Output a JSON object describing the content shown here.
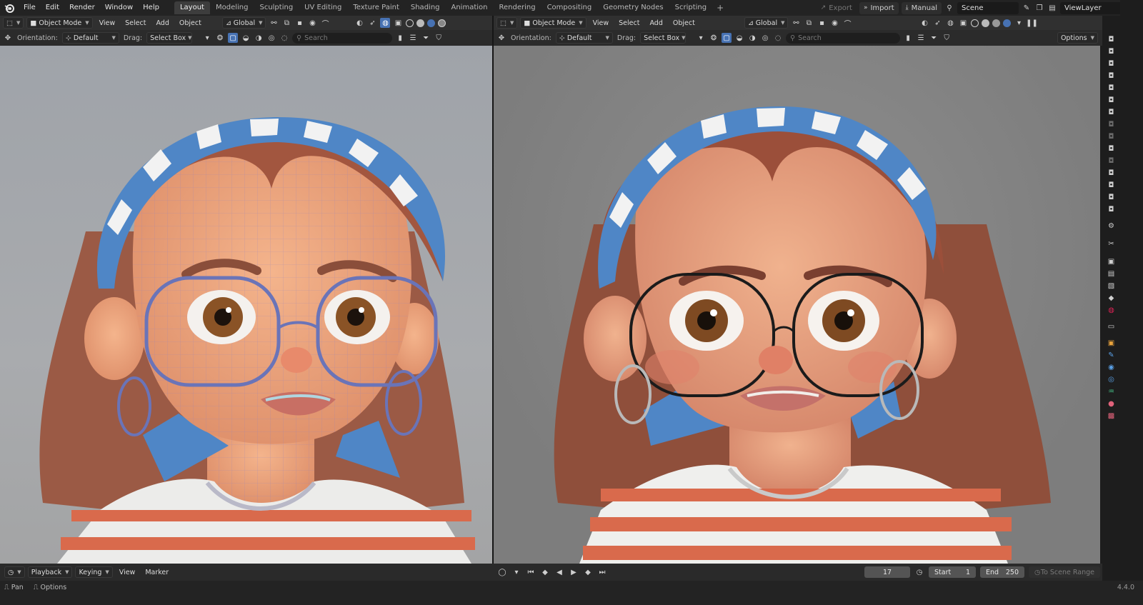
{
  "app": {
    "main_menu": [
      "File",
      "Edit",
      "Render",
      "Window",
      "Help"
    ],
    "workspaces": [
      "Layout",
      "Modeling",
      "Sculpting",
      "UV Editing",
      "Texture Paint",
      "Shading",
      "Animation",
      "Rendering",
      "Compositing",
      "Geometry Nodes",
      "Scripting"
    ],
    "active_workspace": "Layout",
    "export_label": "Export",
    "import_label": "Import",
    "manual_label": "Manual",
    "scene_name": "Scene",
    "viewlayer_name": "ViewLayer"
  },
  "left_viewport": {
    "mode": "Object Mode",
    "menus": [
      "View",
      "Select",
      "Add",
      "Object"
    ],
    "transform_space": "Global",
    "orientation_label": "Orientation:",
    "orientation_value": "Default",
    "drag_label": "Drag:",
    "drag_value": "Select Box",
    "search_placeholder": "Search",
    "shading": "wireframe-overlay"
  },
  "right_viewport": {
    "mode": "Object Mode",
    "menus": [
      "View",
      "Select",
      "Add",
      "Object"
    ],
    "transform_space": "Global",
    "orientation_label": "Orientation:",
    "orientation_value": "Default",
    "drag_label": "Drag:",
    "drag_value": "Select Box",
    "search_placeholder": "Search",
    "options_label": "Options",
    "shading": "rendered"
  },
  "timeline": {
    "menus": [
      "Playback",
      "Keying",
      "View",
      "Marker"
    ],
    "current_frame": "17",
    "start_label": "Start",
    "start_value": "1",
    "end_label": "End",
    "end_value": "250",
    "range_label": "To Scene Range"
  },
  "status_bar": {
    "items": [
      "Pan",
      "Options"
    ],
    "version": "4.4.0"
  },
  "colors": {
    "accent": "#4772b3",
    "header_bg": "#303030",
    "shirt_stripe": "#d96a4c",
    "bandana": "#4f86c6"
  },
  "icons": [
    "blender-logo",
    "move-tool-icon",
    "camera-icon",
    "wrench-icon",
    "material-icon"
  ]
}
